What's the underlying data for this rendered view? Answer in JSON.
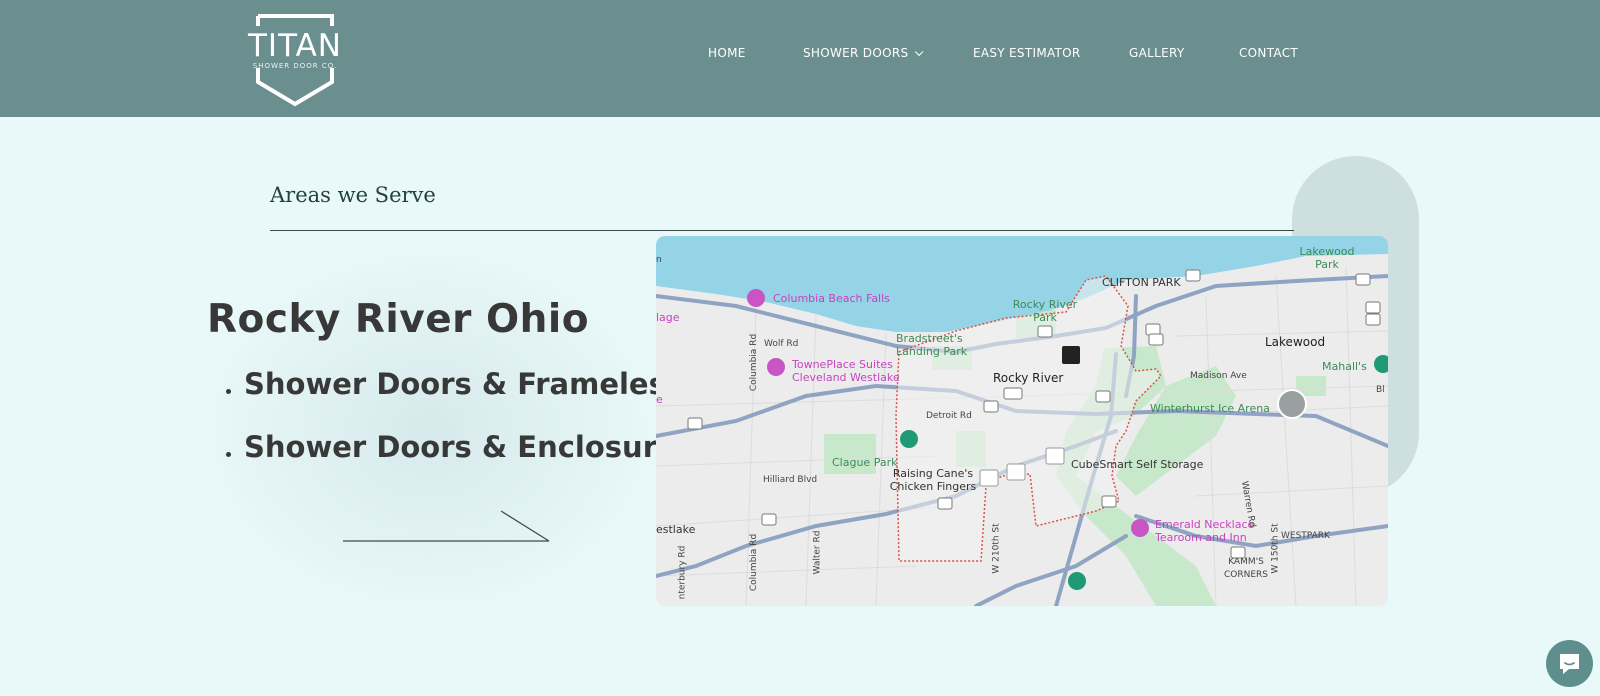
{
  "brand": {
    "name": "TITAN",
    "tagline": "SHOWER DOOR CO."
  },
  "nav": [
    {
      "label": "HOME"
    },
    {
      "label": "SHOWER DOORS",
      "has_dropdown": true
    },
    {
      "label": "EASY ESTIMATOR"
    },
    {
      "label": "GALLERY"
    },
    {
      "label": "CONTACT"
    }
  ],
  "section": {
    "title": "Areas we Serve",
    "city": "Rocky River Ohio",
    "services": [
      "Shower Doors & Frameless",
      "Shower Doors & Enclosures"
    ]
  },
  "map": {
    "labels": {
      "clifton_park": "CLIFTON PARK",
      "lakewood_park": "Lakewood Park",
      "columbia_beach": "Columbia Beach Falls",
      "rocky_river_park": "Rocky River Park",
      "bradstreets": "Bradstreet's Landing Park",
      "lakewood": "Lakewood",
      "mahalls": "Mahall's",
      "towneplace": "TownePlace Suites Cleveland Westlake",
      "rocky_river": "Rocky River",
      "madison": "Madison Ave",
      "winterhurst": "Winterhurst Ice Arena",
      "detroit_rd": "Detroit Rd",
      "clague_park": "Clague Park",
      "hilliard": "Hilliard Blvd",
      "raising_canes": "Raising Cane's Chicken Fingers",
      "cubesmart": "CubeSmart Self Storage",
      "emerald": "Emerald Necklace Tearoom and Inn",
      "westpark": "WESTPARK",
      "kamms": "KAMM'S CORNERS",
      "westlake": "estlake",
      "w210": "W 210th St",
      "w150": "W 150th St",
      "columbia_rd": "Columbia Rd",
      "walter_rd": "Walter Rd",
      "warren_rd": "Warren Rd",
      "bury_rd": "nterbury Rd",
      "wolf_rd": "Wolf Rd",
      "lage": "lage",
      "on": "n",
      "e": "e",
      "bi": "Bl"
    },
    "shields": [
      "20",
      "6",
      "2",
      "ALT",
      "6",
      "6",
      "254",
      "90",
      "20",
      "90",
      "20",
      "20",
      "20",
      "10",
      "ALT",
      "6",
      "20"
    ]
  },
  "colors": {
    "header": "#6a8f8e",
    "page_bg": "#e9f8f8",
    "text_dark": "#383838",
    "title": "#23413f",
    "pill": "#cde0df",
    "water": "#94d4e6",
    "chat": "#5f8f8c"
  },
  "icons": {
    "chat": "chat-bubble-icon",
    "dropdown": "chevron-down-icon",
    "hotel": "hotel-icon",
    "golf": "golf-icon"
  }
}
